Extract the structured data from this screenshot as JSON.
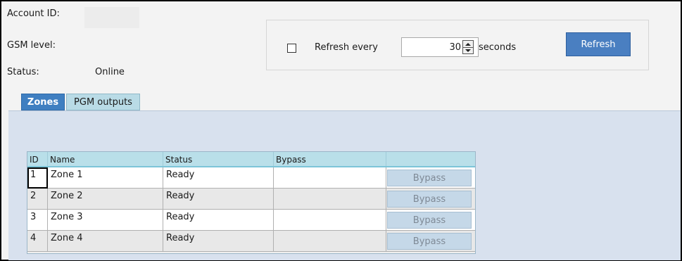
{
  "info": {
    "account_id_label": "Account ID:",
    "account_id_value": "",
    "gsm_level_label": "GSM level:",
    "gsm_level_value": "",
    "status_label": "Status:",
    "status_value": "Online"
  },
  "refresh": {
    "checkbox_label": "Refresh every",
    "checked": false,
    "interval": "30",
    "unit": "seconds",
    "button_label": "Refresh"
  },
  "tabs": [
    {
      "label": "Zones",
      "active": true
    },
    {
      "label": "PGM outputs",
      "active": false
    }
  ],
  "zones_table": {
    "columns": [
      "ID",
      "Name",
      "Status",
      "Bypass"
    ],
    "rows": [
      {
        "id": "1",
        "name": "Zone 1",
        "status": "Ready",
        "bypass": "",
        "action": "Bypass"
      },
      {
        "id": "2",
        "name": "Zone 2",
        "status": "Ready",
        "bypass": "",
        "action": "Bypass"
      },
      {
        "id": "3",
        "name": "Zone 3",
        "status": "Ready",
        "bypass": "",
        "action": "Bypass"
      },
      {
        "id": "4",
        "name": "Zone 4",
        "status": "Ready",
        "bypass": "",
        "action": "Bypass"
      }
    ]
  },
  "colors": {
    "accent_button": "#4a7fc1",
    "tab_active": "#3f7fc1",
    "tab_inactive": "#b9dbe6",
    "panel_background": "#d8e1ee",
    "grid_header": "#b9dfe9",
    "row_alt": "#e8e8e8"
  }
}
